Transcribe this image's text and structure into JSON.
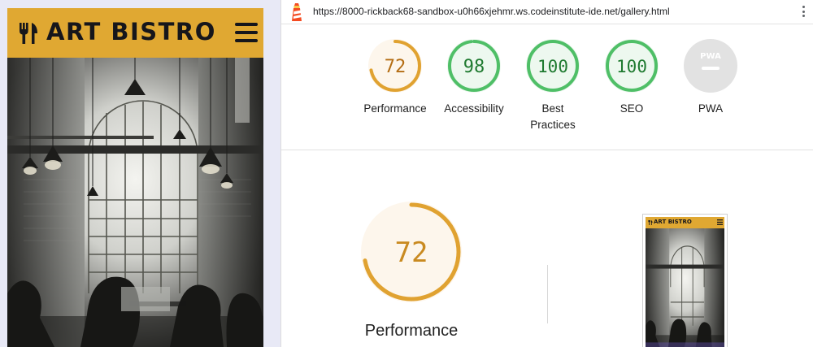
{
  "site": {
    "title": "ART BISTRO",
    "brand_color": "#e0a832",
    "logo_icon": "fork-knife-icon",
    "menu_icon": "hamburger-icon"
  },
  "browser": {
    "url": "https://8000-rickback68-sandbox-u0h66xjehmr.ws.codeinstitute-ide.net/gallery.html",
    "favicon": "lighthouse-icon",
    "menu_icon": "kebab-menu-icon"
  },
  "scores": [
    {
      "id": "performance",
      "label": "Performance",
      "value": 72,
      "display": "72",
      "color": "#e0a231",
      "bg": "#fdf6ec",
      "text_color": "#b46d13"
    },
    {
      "id": "accessibility",
      "label": "Accessibility",
      "value": 98,
      "display": "98",
      "color": "#4fbf67",
      "bg": "#edf8ef",
      "text_color": "#1f7a30"
    },
    {
      "id": "best-practices",
      "label": "Best Practices",
      "value": 100,
      "display": "100",
      "color": "#4fbf67",
      "bg": "#edf8ef",
      "text_color": "#1f7a30"
    },
    {
      "id": "seo",
      "label": "SEO",
      "value": 100,
      "display": "100",
      "color": "#4fbf67",
      "bg": "#edf8ef",
      "text_color": "#1f7a30"
    },
    {
      "id": "pwa",
      "label": "PWA",
      "badge": "PWA",
      "color": "#cccccc",
      "bg": "#e2e2e2"
    }
  ],
  "detail": {
    "label": "Performance",
    "value": 72,
    "display": "72",
    "color": "#e0a231",
    "bg": "#fdf6ec",
    "text_color": "#c98a20"
  },
  "thumbnail": {
    "title": "ART BISTRO"
  }
}
